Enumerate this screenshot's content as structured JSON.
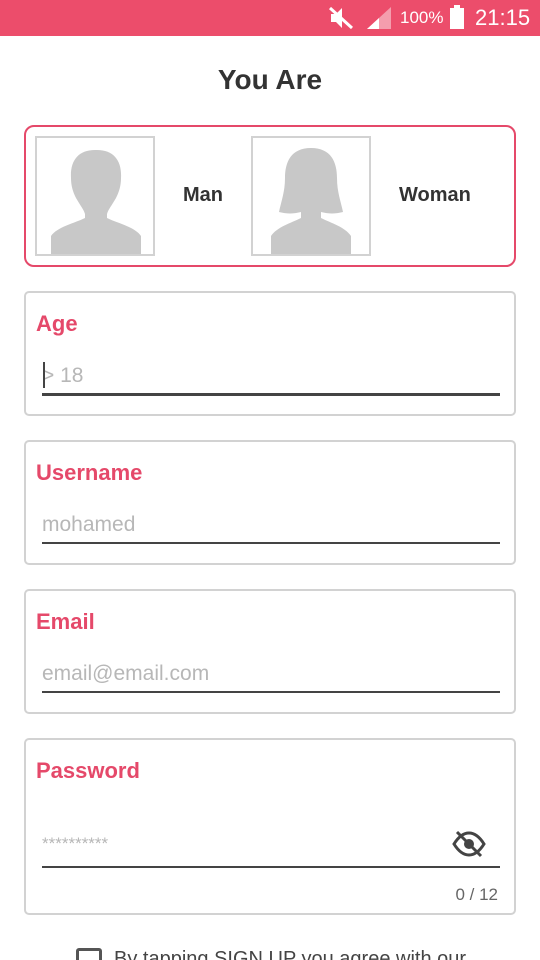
{
  "status_bar": {
    "battery_percent": "100%",
    "time": "21:15",
    "icons": [
      "mute-icon",
      "signal-icon",
      "battery-icon"
    ]
  },
  "title": "You Are",
  "gender": {
    "options": [
      {
        "label": "Man",
        "icon": "man-avatar-icon"
      },
      {
        "label": "Woman",
        "icon": "woman-avatar-icon"
      }
    ]
  },
  "fields": {
    "age": {
      "label": "Age",
      "value": "",
      "placeholder": "> 18"
    },
    "username": {
      "label": "Username",
      "value": "",
      "placeholder": "mohamed"
    },
    "email": {
      "label": "Email",
      "value": "",
      "placeholder": "email@email.com"
    },
    "password": {
      "label": "Password",
      "value": "",
      "placeholder": "**********",
      "counter": "0 / 12",
      "toggle_icon": "eye-off-icon"
    }
  },
  "terms": {
    "text": "By tapping SIGN UP you agree with our"
  },
  "colors": {
    "accent": "#e5496a",
    "status_bar": "#ec4d6b",
    "border": "#d2d2d2"
  }
}
